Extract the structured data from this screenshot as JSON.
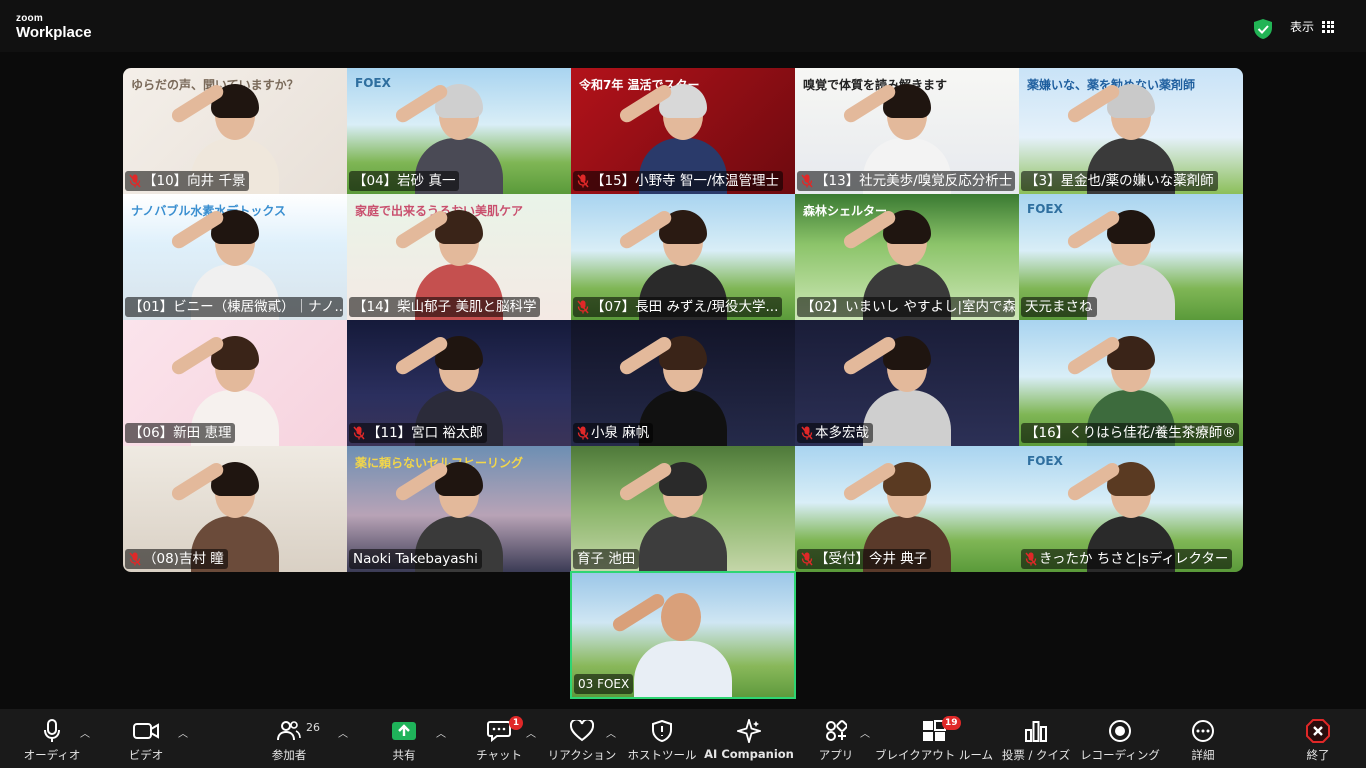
{
  "app": {
    "logo_line1": "zoom",
    "logo_line2": "Workplace"
  },
  "topbar": {
    "view_label": "表示"
  },
  "participants": [
    {
      "name": "【10】向井 千景",
      "muted": true,
      "overlay": "ゆらだの声、聞いていますか？"
    },
    {
      "name": "【04】岩砂 真一",
      "muted": false,
      "overlay": "FOEX"
    },
    {
      "name": "【15】小野寺 智一/体温管理士",
      "muted": true,
      "overlay": "令和7年 温活でスター"
    },
    {
      "name": "【13】社元美歩/嗅覚反応分析士",
      "muted": true,
      "overlay": "嗅覚で体質を読み解きます"
    },
    {
      "name": "【3】星金也/薬の嫌いな薬剤師",
      "muted": false,
      "overlay": "薬嫌いな、薬を勧めない薬剤師"
    },
    {
      "name": "【01】ビニー（棟居微貳）｜ナノ...",
      "muted": false,
      "overlay": "ナノバブル水素水デトックス"
    },
    {
      "name": "【14】柴山郁子 美肌と脳科学",
      "muted": false,
      "overlay": "家庭で出来るうるおい美肌ケア"
    },
    {
      "name": "【07】長田 みずえ/現役大学...",
      "muted": true,
      "overlay": ""
    },
    {
      "name": "【02】いまいし やすよし|室内で森...",
      "muted": false,
      "overlay": "森林シェルター"
    },
    {
      "name": "天元まさね",
      "muted": false,
      "overlay": "FOEX"
    },
    {
      "name": "【06】新田 恵理",
      "muted": false,
      "overlay": ""
    },
    {
      "name": "【11】宮口 裕太郎",
      "muted": true,
      "overlay": ""
    },
    {
      "name": "小泉 麻帆",
      "muted": true,
      "overlay": ""
    },
    {
      "name": "本多宏哉",
      "muted": true,
      "overlay": ""
    },
    {
      "name": "【16】くりはら佳花/養生茶療師®",
      "muted": false,
      "overlay": ""
    },
    {
      "name": "（08)吉村 瞳",
      "muted": true,
      "overlay": ""
    },
    {
      "name": "Naoki Takebayashi",
      "muted": false,
      "overlay": "薬に頼らないセルフヒーリング"
    },
    {
      "name": "育子 池田",
      "muted": false,
      "overlay": ""
    },
    {
      "name": "【受付】今井 典子",
      "muted": true,
      "overlay": ""
    },
    {
      "name": "きったか ちさと|sディレクター",
      "muted": true,
      "overlay": "FOEX"
    }
  ],
  "self_view": {
    "name": "03 FOEX",
    "muted": false
  },
  "toolbar": {
    "audio": "オーディオ",
    "video": "ビデオ",
    "participants": "参加者",
    "participants_count": "26",
    "share": "共有",
    "chat": "チャット",
    "chat_badge": "1",
    "reactions": "リアクション",
    "host_tools": "ホストツール",
    "ai_companion": "AI Companion",
    "apps": "アプリ",
    "breakout": "ブレイクアウト ルーム",
    "breakout_badge": "19",
    "polls": "投票 / クイズ",
    "recording": "レコーディング",
    "more": "詳細",
    "end": "終了"
  },
  "colors": {
    "accent_green": "#2ed573",
    "share_green": "#1fb35a",
    "end_red": "#e02828"
  }
}
